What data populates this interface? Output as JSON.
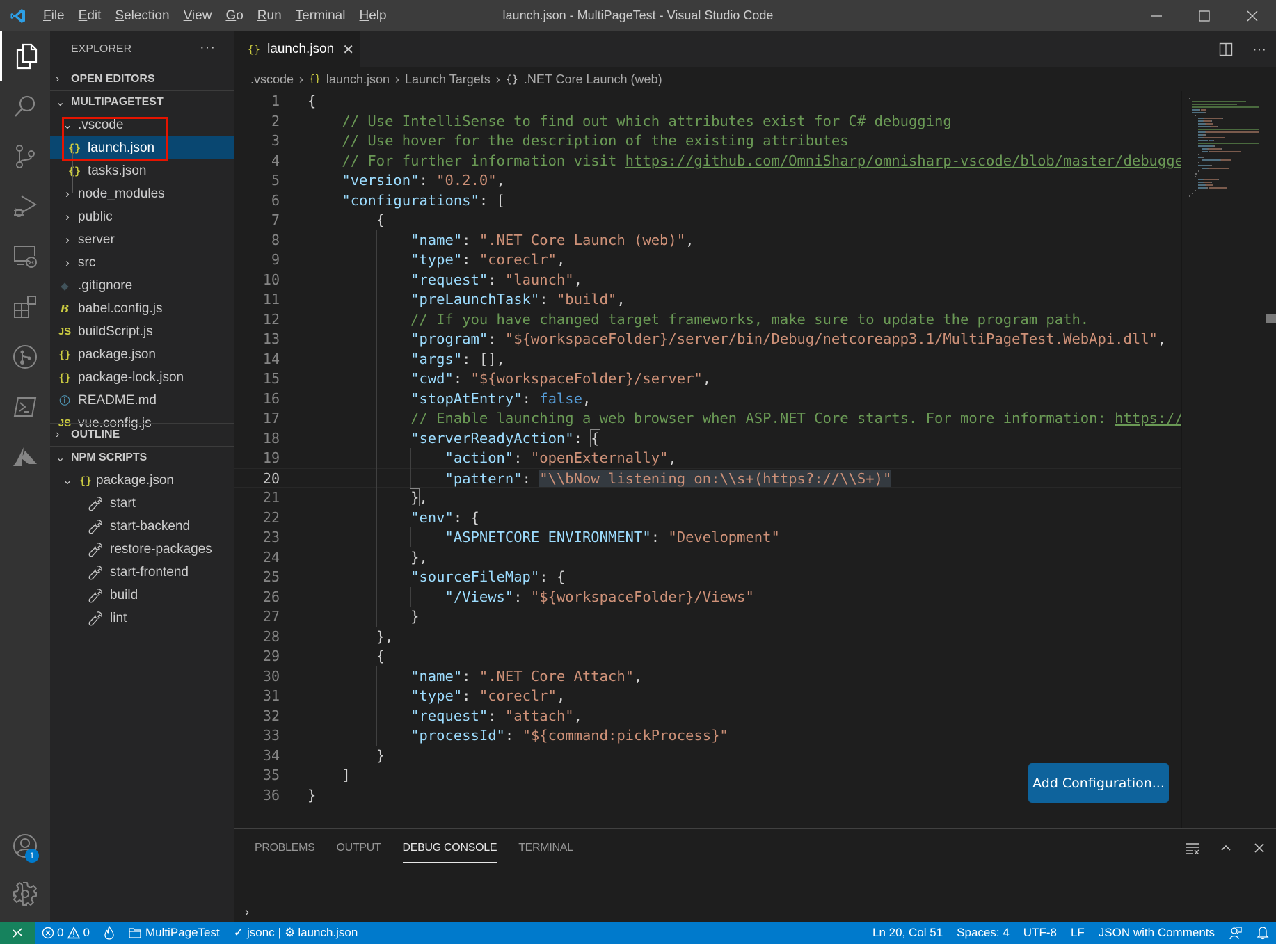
{
  "titlebar": {
    "menu": [
      "File",
      "Edit",
      "Selection",
      "View",
      "Go",
      "Run",
      "Terminal",
      "Help"
    ],
    "window_title": "launch.json - MultiPageTest - Visual Studio Code"
  },
  "activitybar": {
    "items": [
      "explorer",
      "search",
      "source-control",
      "run-debug",
      "remote-explorer",
      "extensions",
      "git-graph",
      "powershell",
      "azure"
    ],
    "accounts_badge": "1"
  },
  "sidebar": {
    "title": "EXPLORER",
    "more": "···",
    "open_editors": "OPEN EDITORS",
    "workspace": "MULTIPAGETEST",
    "tree": [
      {
        "label": ".vscode",
        "type": "folder-open",
        "depth": 1
      },
      {
        "label": "launch.json",
        "type": "json",
        "depth": 2,
        "selected": true
      },
      {
        "label": "tasks.json",
        "type": "json",
        "depth": 2
      },
      {
        "label": "node_modules",
        "type": "folder",
        "depth": 1
      },
      {
        "label": "public",
        "type": "folder",
        "depth": 1
      },
      {
        "label": "server",
        "type": "folder",
        "depth": 1
      },
      {
        "label": "src",
        "type": "folder",
        "depth": 1
      },
      {
        "label": ".gitignore",
        "type": "git",
        "depth": 1
      },
      {
        "label": "babel.config.js",
        "type": "babel",
        "depth": 1
      },
      {
        "label": "buildScript.js",
        "type": "js",
        "depth": 1
      },
      {
        "label": "package.json",
        "type": "json",
        "depth": 1
      },
      {
        "label": "package-lock.json",
        "type": "json",
        "depth": 1
      },
      {
        "label": "README.md",
        "type": "info",
        "depth": 1
      },
      {
        "label": "vue.config.js",
        "type": "js",
        "depth": 1
      }
    ],
    "outline": "OUTLINE",
    "npm_scripts": "NPM SCRIPTS",
    "npm_package": "package.json",
    "scripts": [
      "start",
      "start-backend",
      "restore-packages",
      "start-frontend",
      "build",
      "lint"
    ]
  },
  "editor": {
    "tab": {
      "label": "launch.json",
      "close": "✕"
    },
    "breadcrumb": [
      ".vscode",
      "launch.json",
      "Launch Targets",
      ".NET Core Launch (web)"
    ],
    "current_line": 20,
    "lines": [
      [
        [
          "p",
          "{"
        ]
      ],
      [
        [
          "i",
          "    "
        ],
        [
          "c",
          "// Use IntelliSense to find out which attributes exist for C# debugging"
        ]
      ],
      [
        [
          "i",
          "    "
        ],
        [
          "c",
          "// Use hover for the description of the existing attributes"
        ]
      ],
      [
        [
          "i",
          "    "
        ],
        [
          "c",
          "// For further information visit "
        ],
        [
          "cl",
          "https://github.com/OmniSharp/omnisharp-vscode/blob/master/debugger-launchjson.md"
        ]
      ],
      [
        [
          "i",
          "    "
        ],
        [
          "k",
          "\"version\""
        ],
        [
          "p",
          ": "
        ],
        [
          "s",
          "\"0.2.0\""
        ],
        [
          "p",
          ","
        ]
      ],
      [
        [
          "i",
          "    "
        ],
        [
          "k",
          "\"configurations\""
        ],
        [
          "p",
          ": ["
        ]
      ],
      [
        [
          "i",
          "        "
        ],
        [
          "p",
          "{"
        ]
      ],
      [
        [
          "i",
          "            "
        ],
        [
          "k",
          "\"name\""
        ],
        [
          "p",
          ": "
        ],
        [
          "s",
          "\".NET Core Launch (web)\""
        ],
        [
          "p",
          ","
        ]
      ],
      [
        [
          "i",
          "            "
        ],
        [
          "k",
          "\"type\""
        ],
        [
          "p",
          ": "
        ],
        [
          "s",
          "\"coreclr\""
        ],
        [
          "p",
          ","
        ]
      ],
      [
        [
          "i",
          "            "
        ],
        [
          "k",
          "\"request\""
        ],
        [
          "p",
          ": "
        ],
        [
          "s",
          "\"launch\""
        ],
        [
          "p",
          ","
        ]
      ],
      [
        [
          "i",
          "            "
        ],
        [
          "k",
          "\"preLaunchTask\""
        ],
        [
          "p",
          ": "
        ],
        [
          "s",
          "\"build\""
        ],
        [
          "p",
          ","
        ]
      ],
      [
        [
          "i",
          "            "
        ],
        [
          "c",
          "// If you have changed target frameworks, make sure to update the program path."
        ]
      ],
      [
        [
          "i",
          "            "
        ],
        [
          "k",
          "\"program\""
        ],
        [
          "p",
          ": "
        ],
        [
          "s",
          "\"${workspaceFolder}/server/bin/Debug/netcoreapp3.1/MultiPageTest.WebApi.dll\""
        ],
        [
          "p",
          ","
        ]
      ],
      [
        [
          "i",
          "            "
        ],
        [
          "k",
          "\"args\""
        ],
        [
          "p",
          ": [],"
        ]
      ],
      [
        [
          "i",
          "            "
        ],
        [
          "k",
          "\"cwd\""
        ],
        [
          "p",
          ": "
        ],
        [
          "s",
          "\"${workspaceFolder}/server\""
        ],
        [
          "p",
          ","
        ]
      ],
      [
        [
          "i",
          "            "
        ],
        [
          "k",
          "\"stopAtEntry\""
        ],
        [
          "p",
          ": "
        ],
        [
          "b",
          "false"
        ],
        [
          "p",
          ","
        ]
      ],
      [
        [
          "i",
          "            "
        ],
        [
          "c",
          "// Enable launching a web browser when ASP.NET Core starts. For more information: "
        ],
        [
          "cl",
          "https://aka.ms/VSCode-CS-LaunchJson-WebBrowser"
        ]
      ],
      [
        [
          "i",
          "            "
        ],
        [
          "k",
          "\"serverReadyAction\""
        ],
        [
          "p",
          ": "
        ],
        [
          "pb",
          "{"
        ]
      ],
      [
        [
          "i",
          "                "
        ],
        [
          "k",
          "\"action\""
        ],
        [
          "p",
          ": "
        ],
        [
          "s",
          "\"openExternally\""
        ],
        [
          "p",
          ","
        ]
      ],
      [
        [
          "i",
          "                "
        ],
        [
          "k",
          "\"pattern\""
        ],
        [
          "p",
          ": "
        ],
        [
          "sh",
          "\"\\\\bNow listening on:\\\\s+(https?://\\\\S+)\""
        ]
      ],
      [
        [
          "i",
          "            "
        ],
        [
          "pb",
          "}"
        ],
        [
          "p",
          ","
        ]
      ],
      [
        [
          "i",
          "            "
        ],
        [
          "k",
          "\"env\""
        ],
        [
          "p",
          ": {"
        ]
      ],
      [
        [
          "i",
          "                "
        ],
        [
          "k",
          "\"ASPNETCORE_ENVIRONMENT\""
        ],
        [
          "p",
          ": "
        ],
        [
          "s",
          "\"Development\""
        ]
      ],
      [
        [
          "i",
          "            "
        ],
        [
          "p",
          "},"
        ]
      ],
      [
        [
          "i",
          "            "
        ],
        [
          "k",
          "\"sourceFileMap\""
        ],
        [
          "p",
          ": {"
        ]
      ],
      [
        [
          "i",
          "                "
        ],
        [
          "k",
          "\"/Views\""
        ],
        [
          "p",
          ": "
        ],
        [
          "s",
          "\"${workspaceFolder}/Views\""
        ]
      ],
      [
        [
          "i",
          "            "
        ],
        [
          "p",
          "}"
        ]
      ],
      [
        [
          "i",
          "        "
        ],
        [
          "p",
          "},"
        ]
      ],
      [
        [
          "i",
          "        "
        ],
        [
          "p",
          "{"
        ]
      ],
      [
        [
          "i",
          "            "
        ],
        [
          "k",
          "\"name\""
        ],
        [
          "p",
          ": "
        ],
        [
          "s",
          "\".NET Core Attach\""
        ],
        [
          "p",
          ","
        ]
      ],
      [
        [
          "i",
          "            "
        ],
        [
          "k",
          "\"type\""
        ],
        [
          "p",
          ": "
        ],
        [
          "s",
          "\"coreclr\""
        ],
        [
          "p",
          ","
        ]
      ],
      [
        [
          "i",
          "            "
        ],
        [
          "k",
          "\"request\""
        ],
        [
          "p",
          ": "
        ],
        [
          "s",
          "\"attach\""
        ],
        [
          "p",
          ","
        ]
      ],
      [
        [
          "i",
          "            "
        ],
        [
          "k",
          "\"processId\""
        ],
        [
          "p",
          ": "
        ],
        [
          "s",
          "\"${command:pickProcess}\""
        ]
      ],
      [
        [
          "i",
          "        "
        ],
        [
          "p",
          "}"
        ]
      ],
      [
        [
          "i",
          "    "
        ],
        [
          "p",
          "]"
        ]
      ],
      [
        [
          "p",
          "}"
        ]
      ]
    ],
    "add_configuration": "Add Configuration..."
  },
  "panel": {
    "tabs": [
      "PROBLEMS",
      "OUTPUT",
      "DEBUG CONSOLE",
      "TERMINAL"
    ],
    "active_tab": "DEBUG CONSOLE",
    "prompt": "›"
  },
  "statusbar": {
    "errors": "0",
    "warnings": "0",
    "project": "MultiPageTest",
    "schema": "jsonc",
    "schema_file": "launch.json",
    "position": "Ln 20, Col 51",
    "spaces": "Spaces: 4",
    "encoding": "UTF-8",
    "eol": "LF",
    "language": "JSON with Comments"
  },
  "colors": {
    "accent": "#007acc",
    "remote": "#16825d",
    "selection": "#094771",
    "button": "#0e639c",
    "highlight_box": "#e51400"
  }
}
